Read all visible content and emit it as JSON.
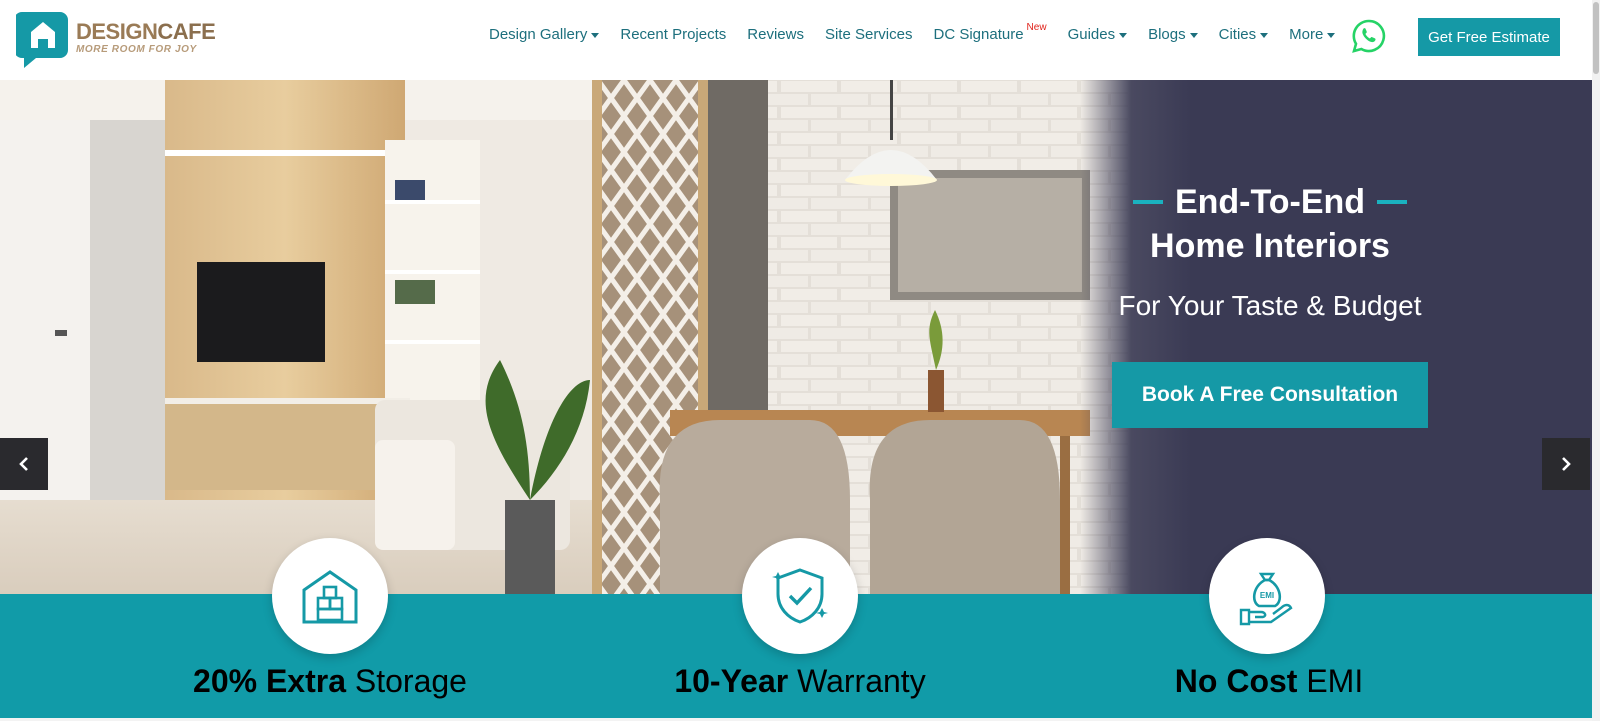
{
  "brand": {
    "name_part1": "DESIGN",
    "name_part2": "CAFE",
    "tagline": "MORE ROOM FOR JOY",
    "color": "#8b6f4e"
  },
  "nav": {
    "items": [
      {
        "label": "Design Gallery",
        "dropdown": true
      },
      {
        "label": "Recent Projects",
        "dropdown": false
      },
      {
        "label": "Reviews",
        "dropdown": false
      },
      {
        "label": "Site Services",
        "dropdown": false
      },
      {
        "label": "DC Signature",
        "dropdown": false,
        "badge": "New"
      },
      {
        "label": "Guides",
        "dropdown": true
      },
      {
        "label": "Blogs",
        "dropdown": true
      },
      {
        "label": "Cities",
        "dropdown": true
      },
      {
        "label": "More",
        "dropdown": true
      }
    ],
    "whatsapp_icon": "whatsapp-icon",
    "cta_label": "Get Free Estimate"
  },
  "hero": {
    "title_line1": "End-To-End",
    "title_line2": "Home Interiors",
    "subtitle": "For Your Taste & Budget",
    "cta_label": "Book A Free Consultation",
    "prev_icon": "chevron-left-icon",
    "next_icon": "chevron-right-icon"
  },
  "features": [
    {
      "bold": "20% Extra",
      "rest": " Storage",
      "icon": "warehouse-boxes-icon"
    },
    {
      "bold": "10-Year",
      "rest": " Warranty",
      "icon": "shield-check-icon"
    },
    {
      "bold": "No Cost",
      "rest": " EMI",
      "icon": "money-bag-hand-icon",
      "icon_text": "EMI"
    }
  ],
  "colors": {
    "accent": "#1599a6",
    "band": "#119ba8",
    "nav_text": "#1d6f7d",
    "hero_panel": "#3a3a54",
    "badge": "#e0231b",
    "whatsapp": "#25d366"
  }
}
